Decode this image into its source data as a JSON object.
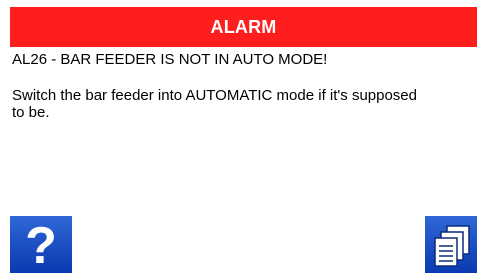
{
  "colors": {
    "header_bg": "#ff1e1e",
    "button_bg_top": "#2f67d6",
    "button_bg_bottom": "#0b3ab0",
    "text": "#000000"
  },
  "header": {
    "title": "ALARM"
  },
  "alarm": {
    "code_line": "AL26 - BAR FEEDER IS NOT IN AUTO MODE!",
    "message": "Switch the bar feeder into AUTOMATIC mode if it's supposed to be."
  },
  "buttons": {
    "help": {
      "icon": "help-question-icon",
      "glyph": "?"
    },
    "log": {
      "icon": "documents-stack-icon"
    }
  }
}
